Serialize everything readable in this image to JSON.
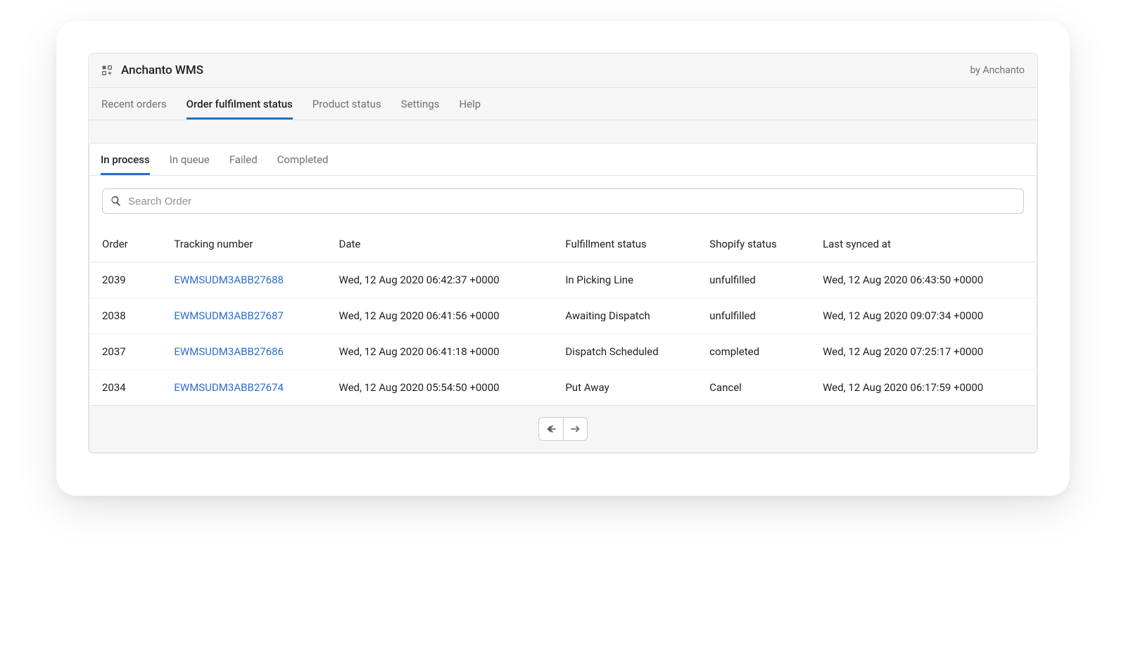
{
  "header": {
    "app_title": "Anchanto WMS",
    "by_line": "by Anchanto"
  },
  "main_tabs": [
    {
      "label": "Recent orders",
      "active": false
    },
    {
      "label": "Order fulfilment status",
      "active": true
    },
    {
      "label": "Product status",
      "active": false
    },
    {
      "label": "Settings",
      "active": false
    },
    {
      "label": "Help",
      "active": false
    }
  ],
  "sub_tabs": [
    {
      "label": "In process",
      "active": true
    },
    {
      "label": "In queue",
      "active": false
    },
    {
      "label": "Failed",
      "active": false
    },
    {
      "label": "Completed",
      "active": false
    }
  ],
  "search": {
    "placeholder": "Search Order",
    "value": ""
  },
  "table": {
    "columns": [
      "Order",
      "Tracking number",
      "Date",
      "Fulfillment status",
      "Shopify status",
      "Last synced at"
    ],
    "rows": [
      {
        "order": "2039",
        "tracking": "EWMSUDM3ABB27688",
        "date": "Wed, 12 Aug 2020 06:42:37 +0000",
        "fulfillment": "In Picking Line",
        "shopify": "unfulfilled",
        "synced": "Wed, 12 Aug 2020 06:43:50 +0000"
      },
      {
        "order": "2038",
        "tracking": "EWMSUDM3ABB27687",
        "date": "Wed, 12 Aug 2020 06:41:56 +0000",
        "fulfillment": "Awaiting Dispatch",
        "shopify": "unfulfilled",
        "synced": "Wed, 12 Aug 2020 09:07:34 +0000"
      },
      {
        "order": "2037",
        "tracking": "EWMSUDM3ABB27686",
        "date": "Wed, 12 Aug 2020 06:41:18 +0000",
        "fulfillment": "Dispatch Scheduled",
        "shopify": "completed",
        "synced": "Wed, 12 Aug 2020 07:25:17 +0000"
      },
      {
        "order": "2034",
        "tracking": "EWMSUDM3ABB27674",
        "date": "Wed, 12 Aug 2020 05:54:50 +0000",
        "fulfillment": "Put Away",
        "shopify": "Cancel",
        "synced": "Wed, 12 Aug 2020 06:17:59 +0000"
      }
    ]
  }
}
